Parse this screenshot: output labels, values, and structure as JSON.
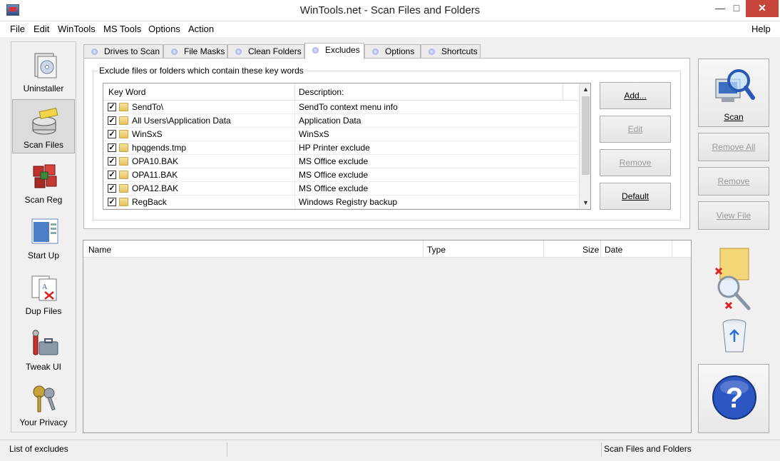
{
  "window": {
    "title": "WinTools.net - Scan Files and Folders",
    "minimize": "—",
    "maximize": "□",
    "close": "✕"
  },
  "menu": {
    "file": "File",
    "edit": "Edit",
    "wintools": "WinTools",
    "mstools": "MS Tools",
    "options": "Options",
    "action": "Action",
    "help": "Help"
  },
  "sidebar": {
    "items": [
      {
        "label": "Uninstaller",
        "icon": "uninstaller-icon"
      },
      {
        "label": "Scan Files",
        "icon": "scan-files-icon",
        "active": true
      },
      {
        "label": "Scan Reg",
        "icon": "scan-registry-icon"
      },
      {
        "label": "Start Up",
        "icon": "startup-icon"
      },
      {
        "label": "Dup Files",
        "icon": "duplicate-files-icon"
      },
      {
        "label": "Tweak UI",
        "icon": "tweak-ui-icon"
      },
      {
        "label": "Your Privacy",
        "icon": "privacy-keys-icon"
      }
    ]
  },
  "tabs": [
    {
      "label": "Drives to Scan"
    },
    {
      "label": "File Masks"
    },
    {
      "label": "Clean Folders"
    },
    {
      "label": "Excludes",
      "active": true
    },
    {
      "label": "Options"
    },
    {
      "label": "Shortcuts"
    }
  ],
  "excludes": {
    "group_label": "Exclude files or folders which contain these key words",
    "columns": {
      "keyword": "Key Word",
      "description": "Description:"
    },
    "rows": [
      {
        "keyword": "SendTo\\",
        "description": "SendTo context menu info",
        "checked": true
      },
      {
        "keyword": "All Users\\Application Data",
        "description": "Application Data",
        "checked": true
      },
      {
        "keyword": "WinSxS",
        "description": "WinSxS",
        "checked": true
      },
      {
        "keyword": "hpqgends.tmp",
        "description": "HP Printer exclude",
        "checked": true
      },
      {
        "keyword": "OPA10.BAK",
        "description": "MS Office exclude",
        "checked": true
      },
      {
        "keyword": "OPA11.BAK",
        "description": "MS Office exclude",
        "checked": true
      },
      {
        "keyword": "OPA12.BAK",
        "description": "MS Office exclude",
        "checked": true
      },
      {
        "keyword": "RegBack",
        "description": "Windows Registry backup",
        "checked": true
      }
    ],
    "buttons": {
      "add": "Add...",
      "edit": "Edit",
      "remove": "Remove",
      "default": "Default"
    }
  },
  "results": {
    "columns": {
      "name": "Name",
      "type": "Type",
      "size": "Size",
      "date": "Date"
    }
  },
  "right_panel": {
    "scan": "Scan",
    "remove_all": "Remove All",
    "remove": "Remove",
    "view_file": "View File"
  },
  "status": {
    "left": "List of excludes",
    "right": "Scan Files and Folders"
  },
  "colors": {
    "close_button": "#c7463b",
    "accent": "#2f6fd0"
  }
}
